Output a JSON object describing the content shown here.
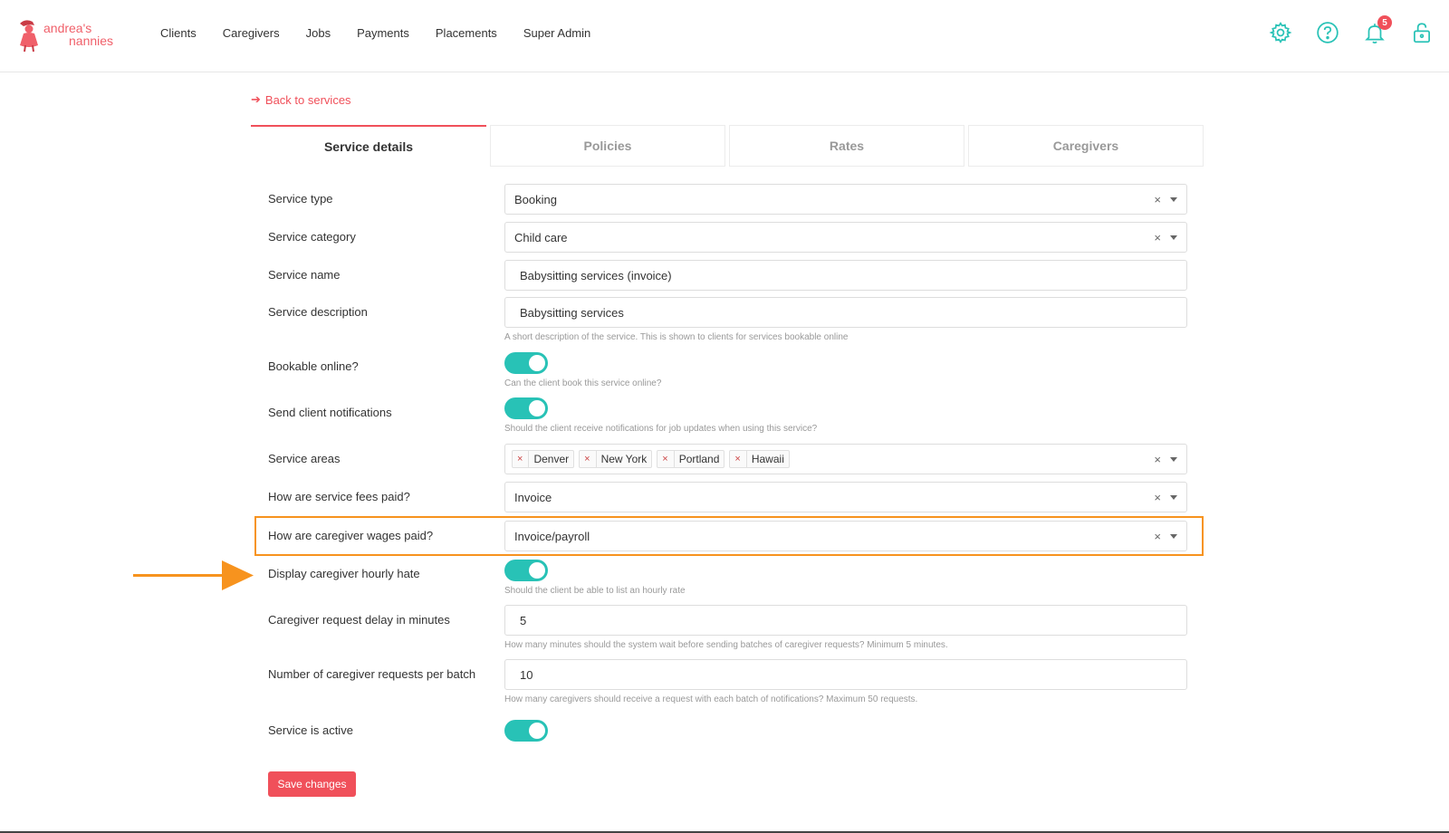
{
  "logo": {
    "line1": "andrea's",
    "line2": "nannies"
  },
  "nav": [
    "Clients",
    "Caregivers",
    "Jobs",
    "Payments",
    "Placements",
    "Super Admin"
  ],
  "header_icons": [
    "settings-icon",
    "help-icon",
    "bell-icon",
    "lock-icon"
  ],
  "notifications_count": "5",
  "back_link": "Back to services",
  "tabs": [
    "Service details",
    "Policies",
    "Rates",
    "Caregivers"
  ],
  "form": {
    "service_type": {
      "label": "Service type",
      "value": "Booking"
    },
    "service_category": {
      "label": "Service category",
      "value": "Child care"
    },
    "service_name": {
      "label": "Service name",
      "value": "Babysitting services (invoice)"
    },
    "service_description": {
      "label": "Service description",
      "value": "Babysitting services",
      "help": "A short description of the service. This is shown to clients for services bookable online"
    },
    "bookable_online": {
      "label": "Bookable online?",
      "enabled": true,
      "help": "Can the client book this service online?"
    },
    "send_notifications": {
      "label": "Send client notifications",
      "enabled": true,
      "help": "Should the client receive notifications for job updates when using this service?"
    },
    "service_areas": {
      "label": "Service areas",
      "tags": [
        "Denver",
        "New York",
        "Portland",
        "Hawaii"
      ]
    },
    "fees_paid": {
      "label": "How are service fees paid?",
      "value": "Invoice"
    },
    "wages_paid": {
      "label": "How are caregiver wages paid?",
      "value": "Invoice/payroll"
    },
    "display_hourly": {
      "label": "Display caregiver hourly hate",
      "enabled": true,
      "help": "Should the client be able to list an hourly rate"
    },
    "request_delay": {
      "label": "Caregiver request delay in minutes",
      "value": "5",
      "help": "How many minutes should the system wait before sending batches of caregiver requests? Minimum 5 minutes."
    },
    "requests_per_batch": {
      "label": "Number of caregiver requests per batch",
      "value": "10",
      "help": "How many caregivers should receive a request with each batch of notifications? Maximum 50 requests."
    },
    "service_active": {
      "label": "Service is active",
      "enabled": true
    }
  },
  "save_label": "Save changes",
  "clear_symbol": "×",
  "colors": {
    "accent": "#f0505a",
    "toggle": "#28c2b6",
    "icon": "#28c2b6",
    "highlight": "#f7931e"
  }
}
